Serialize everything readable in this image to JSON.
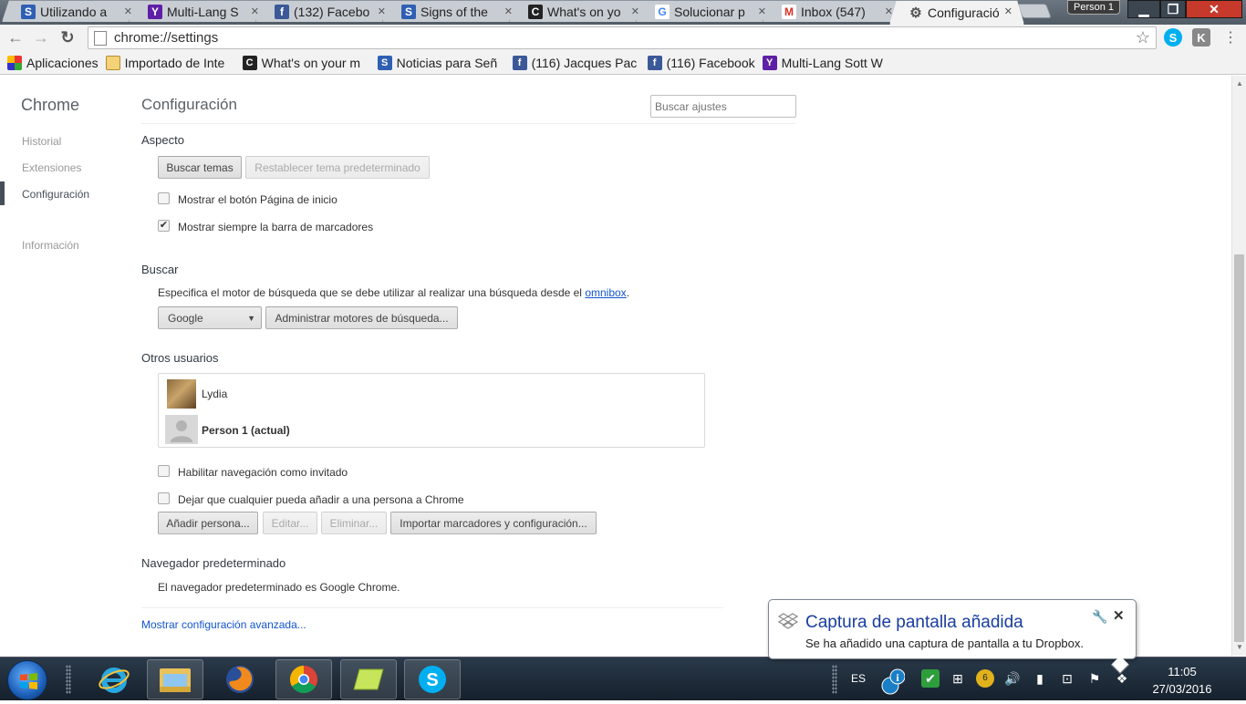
{
  "tabs": [
    {
      "label": "Utilizando a",
      "favicon": "S"
    },
    {
      "label": "Multi-Lang S",
      "favicon": "Y"
    },
    {
      "label": "(132) Facebo",
      "favicon": "f"
    },
    {
      "label": "Signs of the",
      "favicon": "S"
    },
    {
      "label": "What's on yo",
      "favicon": "C"
    },
    {
      "label": "Solucionar p",
      "favicon": "G"
    },
    {
      "label": "Inbox (547)",
      "favicon": "M"
    },
    {
      "label": "Configuració",
      "favicon": "gear-icon"
    }
  ],
  "profile_button": "Person 1",
  "address_bar": {
    "url": "chrome://settings"
  },
  "bookmarks": [
    {
      "label": "Aplicaciones",
      "icon": "apps-icon"
    },
    {
      "label": "Importado de Inte",
      "icon": "folder-icon"
    },
    {
      "label": "What's on your m",
      "icon": "C"
    },
    {
      "label": "Noticias para Señ",
      "icon": "S"
    },
    {
      "label": "(116) Jacques Pac",
      "icon": "f"
    },
    {
      "label": "(116) Facebook",
      "icon": "f"
    },
    {
      "label": "Multi-Lang Sott W",
      "icon": "Y"
    }
  ],
  "sidebar": {
    "title": "Chrome",
    "items": [
      "Historial",
      "Extensiones",
      "Configuración",
      "Información"
    ]
  },
  "settings": {
    "title": "Configuración",
    "search_placeholder": "Buscar ajustes",
    "appearance": {
      "heading": "Aspecto",
      "themes_button": "Buscar temas",
      "reset_theme_button": "Restablecer tema predeterminado",
      "show_home": {
        "label": "Mostrar el botón Página de inicio",
        "checked": false
      },
      "show_bookmarks": {
        "label": "Mostrar siempre la barra de marcadores",
        "checked": true
      }
    },
    "search": {
      "heading": "Buscar",
      "description": "Especifica el motor de búsqueda que se debe utilizar al realizar una búsqueda desde el",
      "link": "omnibox",
      "link_suffix": ".",
      "engine": "Google",
      "manage_button": "Administrar motores de búsqueda..."
    },
    "users": {
      "heading": "Otros usuarios",
      "list": [
        {
          "name": "Lydia",
          "current": false
        },
        {
          "name": "Person 1 (actual)",
          "current": true
        }
      ],
      "guest": {
        "label": "Habilitar navegación como invitado",
        "checked": false
      },
      "anyone_add": {
        "label": "Dejar que cualquier pueda añadir a una persona a Chrome",
        "checked": false
      },
      "add_button": "Añadir persona...",
      "edit_button": "Editar...",
      "delete_button": "Eliminar...",
      "import_button": "Importar marcadores y configuración..."
    },
    "default_browser": {
      "heading": "Navegador predeterminado",
      "text": "El navegador predeterminado es Google Chrome."
    },
    "advanced_link": "Mostrar configuración avanzada..."
  },
  "toast": {
    "title": "Captura de pantalla añadida",
    "message": "Se ha añadido una captura de pantalla a tu Dropbox."
  },
  "taskbar": {
    "language": "ES",
    "time": "11:05",
    "date": "27/03/2016",
    "badge_count": "6"
  }
}
